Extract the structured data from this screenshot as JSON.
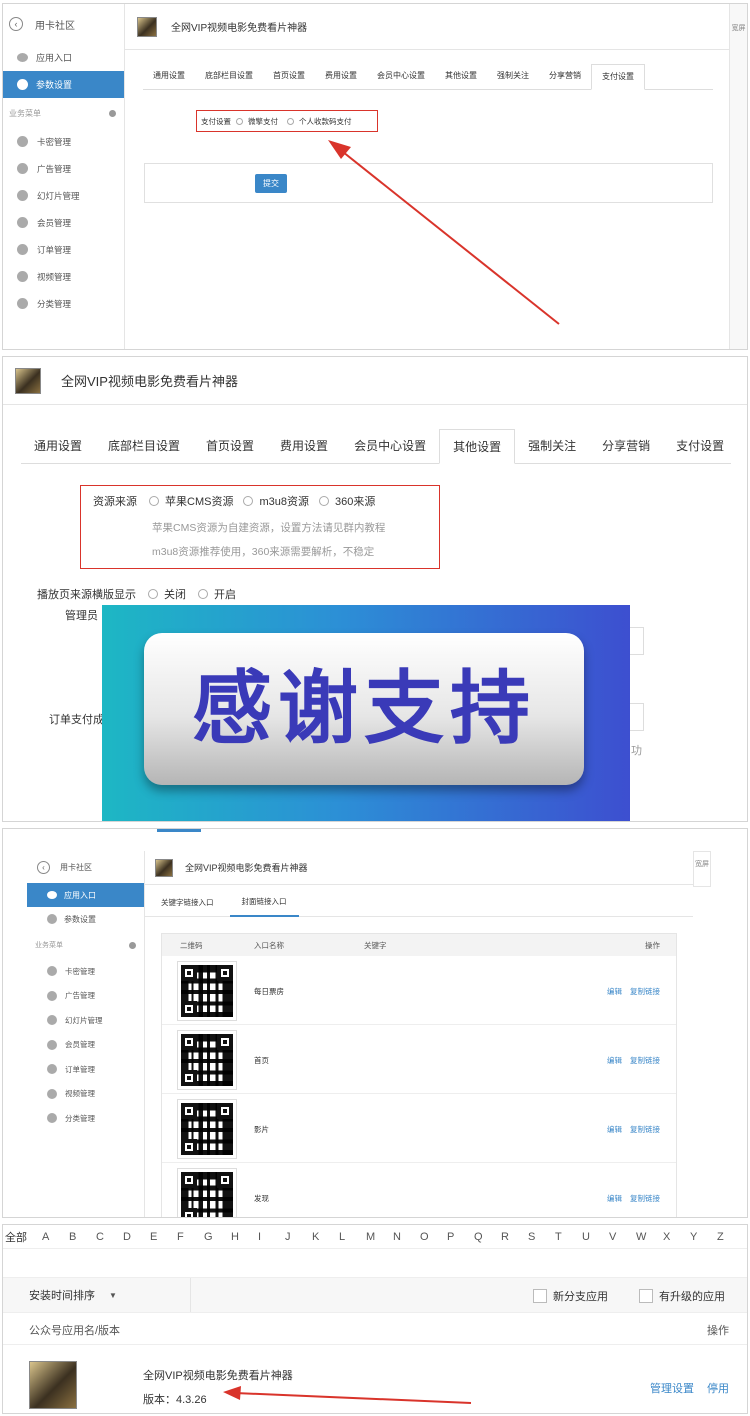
{
  "colors": {
    "accent": "#3a87c8",
    "arrow": "#d9342b",
    "banner_text": "#3a3ab8",
    "banner_bg": "#22a8c8"
  },
  "sidebar": {
    "title": "用卡社区",
    "app_entry": "应用入口",
    "params": "参数设置",
    "section": "业务菜单",
    "items": [
      "卡密管理",
      "广告管理",
      "幻灯片管理",
      "会员管理",
      "订单管理",
      "视频管理",
      "分类管理"
    ]
  },
  "app": {
    "title": "全网VIP视频电影免费看片神器"
  },
  "side_toggle": "宽屏",
  "tabs": [
    "通用设置",
    "底部栏目设置",
    "首页设置",
    "费用设置",
    "会员中心设置",
    "其他设置",
    "强制关注",
    "分享营销",
    "支付设置"
  ],
  "pay": {
    "label": "支付设置",
    "option1": "微擎支付",
    "option2": "个人收款码支付",
    "submit": "提交"
  },
  "other": {
    "source_label": "资源来源",
    "sources": [
      "苹果CMS资源",
      "m3u8资源",
      "360来源"
    ],
    "hint1": "苹果CMS资源为自建资源，设置方法请见群内教程",
    "hint2": "m3u8资源推荐使用，360来源需要解析，不稳定",
    "display_label": "播放页来源横版显示",
    "display_off": "关闭",
    "display_on": "开启",
    "admin_label": "管理员",
    "order_label": "订单支付成",
    "partial": "功"
  },
  "banner": {
    "text": "感谢支持"
  },
  "entry": {
    "tabs": [
      "关键字链接入口",
      "封面链接入口"
    ],
    "headers": {
      "qr": "二维码",
      "name": "入口名称",
      "keyword": "关键字",
      "ops": "操作"
    },
    "rows": [
      {
        "name": "每日票房"
      },
      {
        "name": "首页"
      },
      {
        "name": "影片"
      },
      {
        "name": "发现"
      }
    ],
    "edit": "编辑",
    "copy": "复制链接"
  },
  "apps": {
    "letters": [
      "全部",
      "A",
      "B",
      "C",
      "D",
      "E",
      "F",
      "G",
      "H",
      "I",
      "J",
      "K",
      "L",
      "M",
      "N",
      "O",
      "P",
      "Q",
      "R",
      "S",
      "T",
      "U",
      "V",
      "W",
      "X",
      "Y",
      "Z"
    ],
    "sort": "安装时间排序",
    "filter1": "新分支应用",
    "filter2": "有升级的应用",
    "col_name": "公众号应用名/版本",
    "col_ops": "操作",
    "app_name": "全网VIP视频电影免费看片神器",
    "version": "版本：4.3.26",
    "manage": "管理设置",
    "disable": "停用"
  }
}
